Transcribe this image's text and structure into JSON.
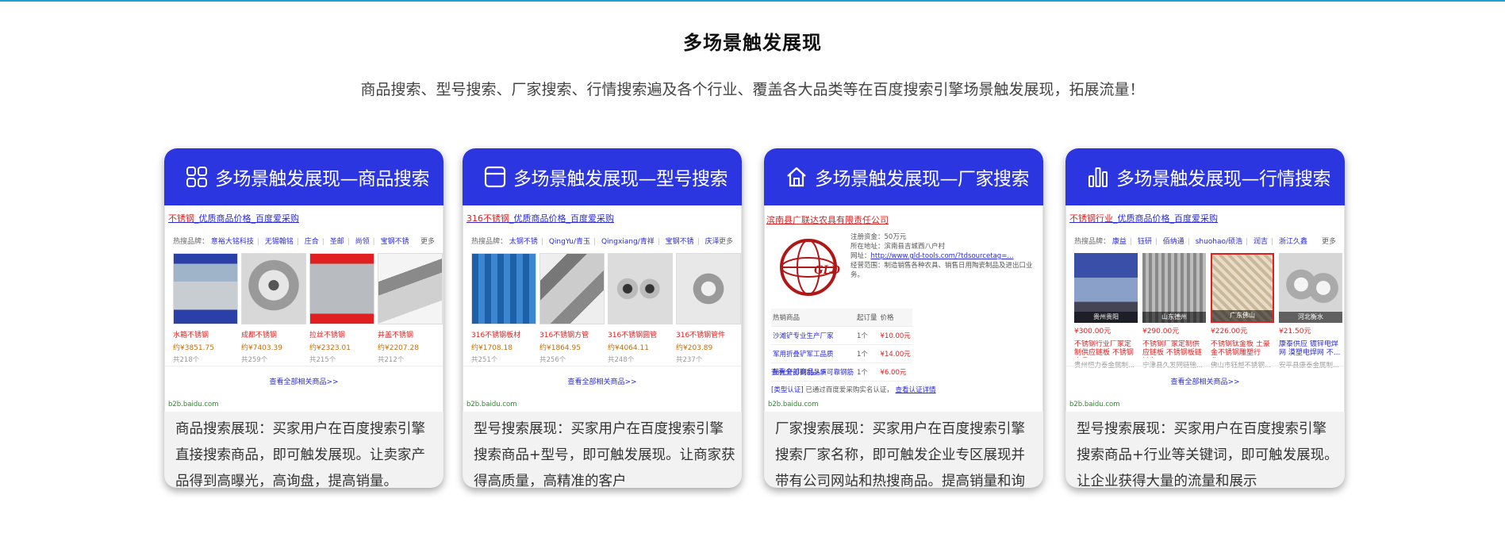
{
  "page": {
    "title": "多场景触发展现",
    "subtitle": "商品搜索、型号搜索、厂家搜索、行情搜索遍及各个行业、覆盖各大品类等在百度搜索引擎场景触发展现，拓展流量！"
  },
  "colors": {
    "header_blue": "#2b35e0",
    "link_blue": "#2a2ad8",
    "price_red": "#e02020",
    "top_line": "#1ea0d8"
  },
  "cards": [
    {
      "icon": "grid-apps-icon",
      "title": "多场景触发展现—商品搜索",
      "shot": {
        "link_red": "不锈钢",
        "link_rest": "_优质商品价格_百度爱采购",
        "hot_label": "热搜品牌：",
        "hot_items": [
          "意裕大铭科技",
          "无锡翰铭",
          "庄合",
          "圣邮",
          "尚领",
          "宝钢不锈"
        ],
        "more": "更多",
        "products": [
          {
            "name": "水箱不锈钢",
            "price": "约¥3851.75",
            "count": "共218个"
          },
          {
            "name": "成都不锈钢",
            "price": "约¥7403.39",
            "count": "共259个"
          },
          {
            "name": "拉丝不锈钢",
            "price": "约¥2323.01",
            "count": "共215个"
          },
          {
            "name": "井盖不锈钢",
            "price": "约¥2207.28",
            "count": "共212个"
          }
        ],
        "view_all": "查看全部相关商品>>",
        "domain": "b2b.baidu.com"
      },
      "desc": "商品搜索展现：买家用户在百度搜索引擎直接搜索商品，即可触发展现。让卖家产品得到高曝光，高询盘，提高销量。"
    },
    {
      "icon": "window-icon",
      "title": "多场景触发展现—型号搜索",
      "shot": {
        "link_red": "316不锈钢",
        "link_rest": "_优质商品价格_百度爱采购",
        "hot_label": "热搜品牌：",
        "hot_items": [
          "太钢不锈",
          "QingYu/青玉",
          "Qingxiang/青祥",
          "宝钢不锈",
          "庆泽"
        ],
        "more": "更多",
        "products": [
          {
            "name": "316不锈钢板材",
            "price": "约¥1708.18",
            "count": "共251个"
          },
          {
            "name": "316不锈钢方管",
            "price": "约¥1864.95",
            "count": "共256个"
          },
          {
            "name": "316不锈钢圆管",
            "price": "约¥4064.11",
            "count": "共248个"
          },
          {
            "name": "316不锈钢管件",
            "price": "约¥203.89",
            "count": "共237个"
          }
        ],
        "view_all": "查看全部相关商品>>",
        "domain": "b2b.baidu.com"
      },
      "desc": "型号搜索展现：买家用户在百度搜索引擎搜索商品+型号，即可触发展现。让商家获得高质量，高精准的客户"
    },
    {
      "icon": "home-icon",
      "title": "多场景触发展现—厂家搜索",
      "shot": {
        "company": "滨南县广联达农具有限责任公司",
        "info_lines": [
          "注册资金：50万元",
          "所在地址：滨南县吉城西八户村",
          "网址：",
          "经营范围：制造销售各种农具、销售日用陶瓷制品及进出口业务。"
        ],
        "website": "http://www.gld-tools.com/?tdsourcetag=...",
        "table_head": [
          "热销商品",
          "起订量",
          "价格"
        ],
        "rows": [
          {
            "name": "沙滩铲专业生产厂家",
            "qty": "1个",
            "price": "¥10.00元"
          },
          {
            "name": "军用折叠铲军工品质",
            "qty": "1个",
            "price": "¥14.00元"
          },
          {
            "name": "殖光开刃钢制品质可靠钢筋",
            "qty": "1个",
            "price": "¥6.00元"
          }
        ],
        "view_all": "查看全部商品>>",
        "verify_label": "[类型认证]",
        "verify_text": "已通过百度爱采购实名认证，",
        "verify_link": "查看认证详情",
        "domain": "b2b.baidu.com"
      },
      "desc": "厂家搜索展现：买家用户在百度搜索引擎搜索厂家名称，即可触发企业专区展现并带有公司网站和热搜商品。提高销量和询盘。"
    },
    {
      "icon": "bar-chart-icon",
      "title": "多场景触发展现—行情搜索",
      "shot": {
        "link_red": "不锈钢行业",
        "link_rest": "_优质商品价格_百度爱采购",
        "hot_label": "热搜品牌：",
        "hot_items": [
          "康益",
          "钰研",
          "佰纳通",
          "shuohao/硕浩",
          "润吉",
          "浙江久鑫"
        ],
        "more": "更多",
        "products": [
          {
            "tag": "贵州贵阳",
            "name": "不锈钢行业厂家定制供应链板 不锈钢产品",
            "price": "¥300.00元",
            "count": "贵州恒力泰金属制..."
          },
          {
            "tag": "山东德州",
            "name": "不锈钢厂家定制供应链板 不锈钢板链链条...",
            "price": "¥290.00元",
            "count": "宁津县久发网链输..."
          },
          {
            "tag": "广东佛山",
            "name": "不锈钢钛金板 土豪金不锈钢雕塑行业...",
            "price": "¥226.00元",
            "count": "佛山市钰越不锈钢..."
          },
          {
            "tag": "河北衡水",
            "name": "康泰供应 镀锌电焊网 漠塑电焊网 不...",
            "price": "¥21.50元",
            "count": "安平县康泰金属制..."
          }
        ],
        "view_all": "查看全部相关商品>>",
        "domain": "b2b.baidu.com"
      },
      "desc": "型号搜索展现：买家用户在百度搜索引擎搜索商品+行业等关键词，即可触发展现。让企业获得大量的流量和展示"
    }
  ]
}
